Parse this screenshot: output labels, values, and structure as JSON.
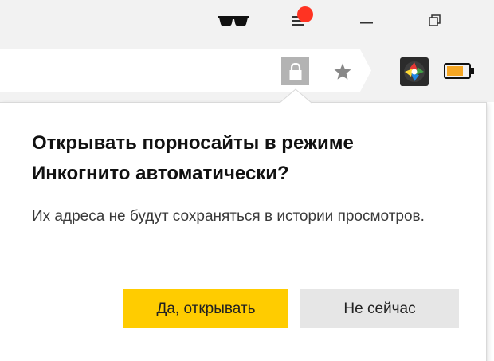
{
  "window_controls": {
    "incognito_icon": "incognito-glasses-icon",
    "menu_icon": "menu-icon",
    "notification_color": "#ff3322",
    "minimize_icon": "minimize-icon",
    "restore_icon": "restore-icon"
  },
  "toolbar": {
    "lock_icon": "lock-icon",
    "star_icon": "bookmark-star-icon",
    "extension_icon": "extension-icon",
    "battery_icon": "battery-saver-icon",
    "battery_color": "#f5a623"
  },
  "popup": {
    "title": "Открывать порносайты в режиме Инкогнито автоматически?",
    "text": "Их адреса не будут сохраняться в истории просмотров.",
    "primary_button": "Да, открывать",
    "secondary_button": "Не сейчас",
    "primary_color": "#ffcc00",
    "secondary_color": "#e6e6e6"
  }
}
